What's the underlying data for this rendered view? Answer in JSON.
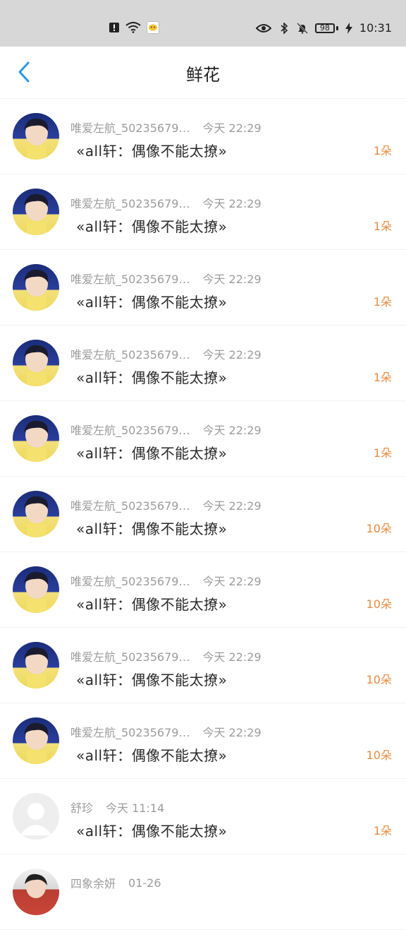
{
  "status_bar": {
    "time": "10:31",
    "battery": "98"
  },
  "header": {
    "title": "鲜花"
  },
  "items": [
    {
      "name": "唯爱左航_50235679…",
      "time": "今天 22:29",
      "message": "«all轩：偶像不能太撩»",
      "count": "1朵"
    },
    {
      "name": "唯爱左航_50235679…",
      "time": "今天 22:29",
      "message": "«all轩：偶像不能太撩»",
      "count": "1朵"
    },
    {
      "name": "唯爱左航_50235679…",
      "time": "今天 22:29",
      "message": "«all轩：偶像不能太撩»",
      "count": "1朵"
    },
    {
      "name": "唯爱左航_50235679…",
      "time": "今天 22:29",
      "message": "«all轩：偶像不能太撩»",
      "count": "1朵"
    },
    {
      "name": "唯爱左航_50235679…",
      "time": "今天 22:29",
      "message": "«all轩：偶像不能太撩»",
      "count": "1朵"
    },
    {
      "name": "唯爱左航_50235679…",
      "time": "今天 22:29",
      "message": "«all轩：偶像不能太撩»",
      "count": "10朵"
    },
    {
      "name": "唯爱左航_50235679…",
      "time": "今天 22:29",
      "message": "«all轩：偶像不能太撩»",
      "count": "10朵"
    },
    {
      "name": "唯爱左航_50235679…",
      "time": "今天 22:29",
      "message": "«all轩：偶像不能太撩»",
      "count": "10朵"
    },
    {
      "name": "唯爱左航_50235679…",
      "time": "今天 22:29",
      "message": "«all轩：偶像不能太撩»",
      "count": "10朵"
    },
    {
      "name": "舒珍",
      "time": "今天 11:14",
      "message": "«all轩：偶像不能太撩»",
      "count": "1朵"
    },
    {
      "name": "四象余妍",
      "time": "01-26",
      "message": "",
      "count": ""
    }
  ],
  "colors": {
    "accent_blue": "#2a97e8",
    "count_orange": "#e68b40",
    "status_bar_bg": "#d7d7d7"
  },
  "icons": {
    "back": "chevron-left-icon",
    "notification": "alert-square-icon",
    "wifi": "wifi-icon",
    "app": "app-notification-icon",
    "eye": "eye-icon",
    "bluetooth": "bluetooth-icon",
    "mute": "bell-off-icon",
    "charging": "lightning-icon"
  }
}
